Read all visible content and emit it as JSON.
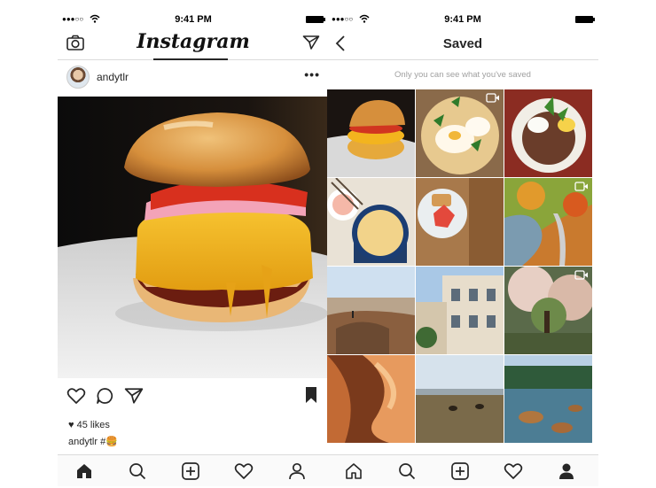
{
  "left_screen": {
    "status": {
      "time": "9:41 PM",
      "signal": "●●●○○"
    },
    "navbar": {
      "logo": "Instagram"
    },
    "post": {
      "username": "andytlr",
      "more": "•••",
      "likes": "45 likes",
      "caption_user": "andytlr",
      "caption_text": "#🍔"
    }
  },
  "right_screen": {
    "status": {
      "time": "9:41 PM",
      "signal": "●●●○○"
    },
    "navbar": {
      "title": "Saved"
    },
    "note": "Only you can see what you've saved",
    "grid": [
      {
        "name": "burger",
        "video": false
      },
      {
        "name": "eggs-benedict",
        "video": true
      },
      {
        "name": "salad-bowl",
        "video": false
      },
      {
        "name": "dumplings-soup",
        "video": false
      },
      {
        "name": "strawberry-toast",
        "video": false
      },
      {
        "name": "autumn-river",
        "video": true
      },
      {
        "name": "canyon-cliff",
        "video": false
      },
      {
        "name": "victorian-houses",
        "video": false
      },
      {
        "name": "blossom-tree",
        "video": true
      },
      {
        "name": "antelope-canyon",
        "video": false
      },
      {
        "name": "grazing-field",
        "video": false
      },
      {
        "name": "lake-rocks",
        "video": false
      }
    ]
  },
  "colors": {
    "text": "#262626",
    "border": "#dbdbdb",
    "muted": "#a0a0a0"
  }
}
